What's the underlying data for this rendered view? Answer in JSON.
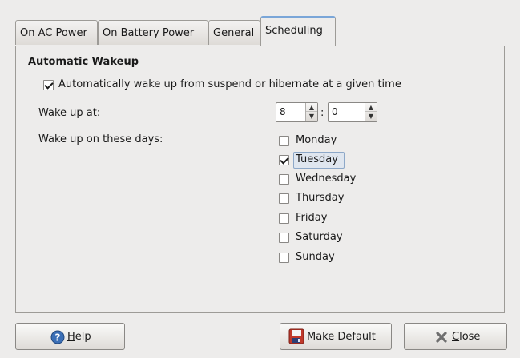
{
  "tabs": [
    {
      "label": "On AC Power"
    },
    {
      "label": "On Battery Power"
    },
    {
      "label": "General"
    },
    {
      "label": "Scheduling"
    }
  ],
  "section": {
    "heading": "Automatic Wakeup",
    "enable_label": "Automatically wake up from suspend or hibernate at a given time",
    "enable_checked": true
  },
  "wake_time": {
    "label": "Wake up at:",
    "hour": "8",
    "separator": ":",
    "minute": "0"
  },
  "days": {
    "label": "Wake up on these days:",
    "items": [
      {
        "label": "Monday",
        "checked": false
      },
      {
        "label": "Tuesday",
        "checked": true
      },
      {
        "label": "Wednesday",
        "checked": false
      },
      {
        "label": "Thursday",
        "checked": false
      },
      {
        "label": "Friday",
        "checked": false
      },
      {
        "label": "Saturday",
        "checked": false
      },
      {
        "label": "Sunday",
        "checked": false
      }
    ]
  },
  "buttons": {
    "help_mnemonic": "H",
    "help_rest": "elp",
    "make_default": "Make Default",
    "close_mnemonic": "C",
    "close_rest": "lose"
  },
  "colors": {
    "window_bg": "#edeceb",
    "active_tab_accent": "#7aa6d8",
    "help_icon": "#3b6fb6",
    "close_icon": "#6f6f6f"
  }
}
